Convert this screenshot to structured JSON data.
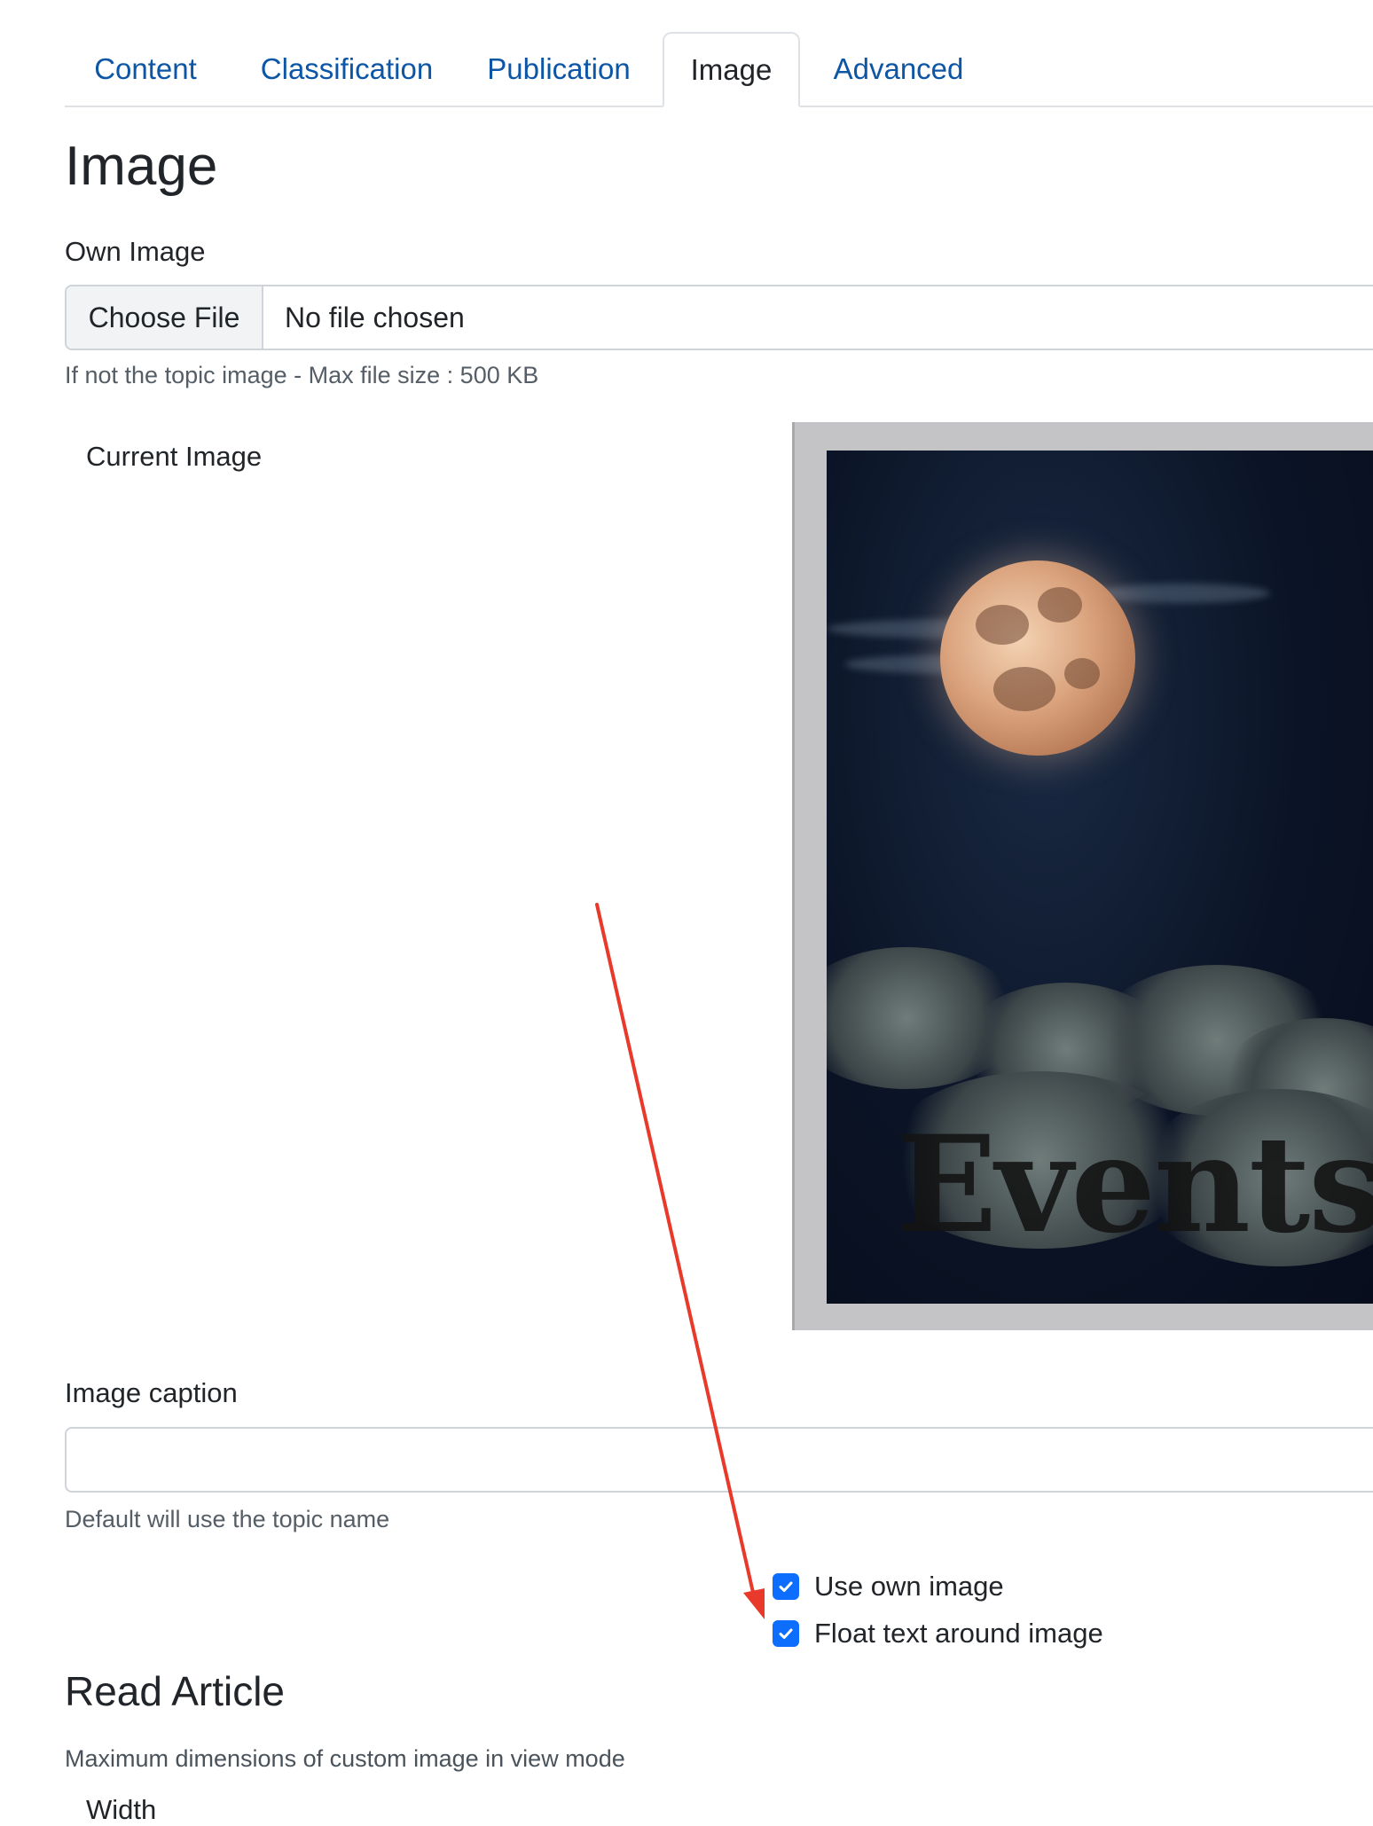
{
  "tabs": [
    {
      "label": "Content",
      "active": false
    },
    {
      "label": "Classification",
      "active": false
    },
    {
      "label": "Publication",
      "active": false
    },
    {
      "label": "Image",
      "active": true
    },
    {
      "label": "Advanced",
      "active": false
    }
  ],
  "section_title": "Image",
  "own_image": {
    "label": "Own Image",
    "button_label": "Choose File",
    "file_status": "No file chosen",
    "help": "If not the topic image - Max file size : 500 KB"
  },
  "current_image": {
    "label": "Current Image",
    "image_text": "Events"
  },
  "image_caption": {
    "label": "Image caption",
    "value": "",
    "help": "Default will use the topic name"
  },
  "checkboxes": [
    {
      "label": "Use own image",
      "checked": true
    },
    {
      "label": "Float text around image",
      "checked": true
    }
  ],
  "read_article": {
    "title": "Read Article",
    "help": "Maximum dimensions of custom image in view mode",
    "width_label": "Width"
  },
  "annotation": {
    "color": "#e8392b"
  },
  "colors": {
    "link": "#0d56a6",
    "checkbox": "#0d6efd"
  }
}
